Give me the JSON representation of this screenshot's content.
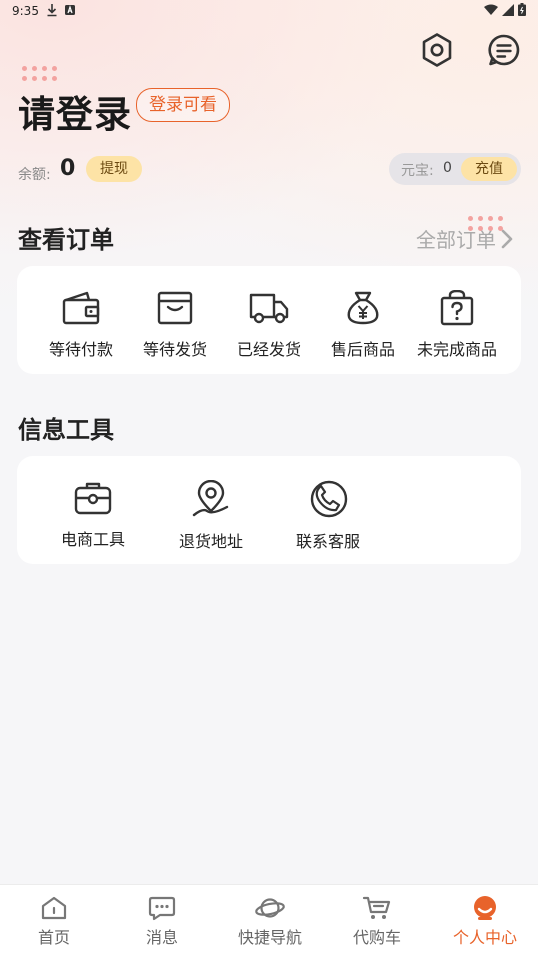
{
  "status_bar": {
    "time": "9:35"
  },
  "profile": {
    "title": "请登录",
    "login_tag": "登录可看"
  },
  "wallet": {
    "balance_label": "余额:",
    "balance_value": "0",
    "withdraw_label": "提现",
    "coin_label": "元宝:",
    "coin_value": "0",
    "recharge_label": "充值"
  },
  "orders": {
    "title": "查看订单",
    "all_orders_label": "全部订单",
    "items": [
      {
        "label": "等待付款",
        "icon": "wallet-icon"
      },
      {
        "label": "等待发货",
        "icon": "box-icon"
      },
      {
        "label": "已经发货",
        "icon": "truck-icon"
      },
      {
        "label": "售后商品",
        "icon": "money-bag-icon"
      },
      {
        "label": "未完成商品",
        "icon": "question-bag-icon"
      }
    ]
  },
  "tools": {
    "title": "信息工具",
    "items": [
      {
        "label": "电商工具",
        "icon": "briefcase-icon"
      },
      {
        "label": "退货地址",
        "icon": "location-pin-icon"
      },
      {
        "label": "联系客服",
        "icon": "phone-icon"
      }
    ]
  },
  "tabbar": {
    "items": [
      {
        "label": "首页",
        "icon": "home-icon"
      },
      {
        "label": "消息",
        "icon": "chat-icon"
      },
      {
        "label": "快捷导航",
        "icon": "planet-icon"
      },
      {
        "label": "代购车",
        "icon": "cart-icon"
      },
      {
        "label": "个人中心",
        "icon": "user-center-icon"
      }
    ],
    "active_index": 4
  },
  "colors": {
    "accent": "#e8632b",
    "badge_bg": "#fde3a6",
    "badge_text": "#6d4b12"
  }
}
